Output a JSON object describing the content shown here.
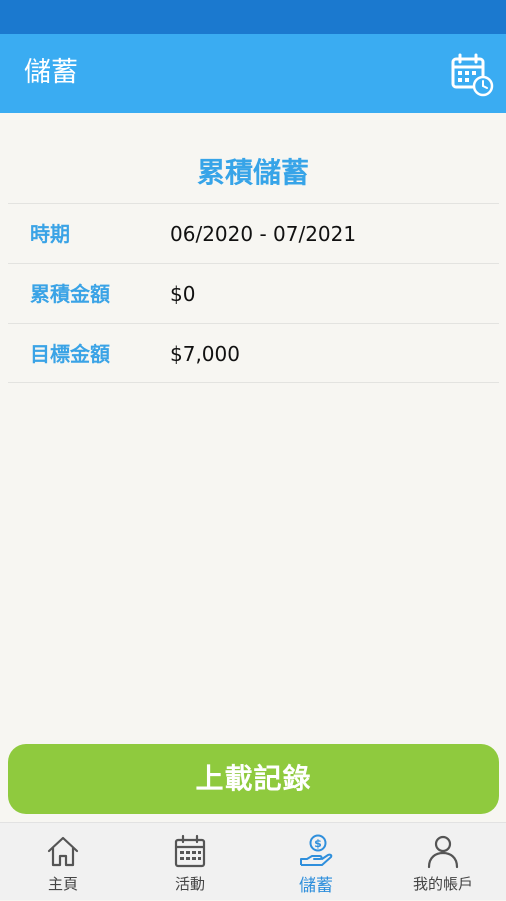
{
  "app_bar": {
    "title": "儲蓄",
    "calendar_icon": "calendar-clock-icon"
  },
  "summary": {
    "title": "累積儲蓄",
    "rows": [
      {
        "label": "時期",
        "value": "06/2020 - 07/2021"
      },
      {
        "label": "累積金額",
        "value": "$0"
      },
      {
        "label": "目標金額",
        "value": "$7,000"
      }
    ]
  },
  "actions": {
    "upload_label": "上載記錄"
  },
  "bottom_nav": {
    "items": [
      {
        "label": "主頁",
        "icon": "home-icon",
        "active": false
      },
      {
        "label": "活動",
        "icon": "calendar-icon",
        "active": false
      },
      {
        "label": "儲蓄",
        "icon": "savings-hand-dollar-icon",
        "active": true
      },
      {
        "label": "我的帳戶",
        "icon": "user-icon",
        "active": false
      }
    ]
  },
  "colors": {
    "status_bar": "#1b79cf",
    "app_bar": "#3aacf2",
    "accent_text": "#37a4e8",
    "button_green": "#8fca3e",
    "nav_active": "#2f8fdc",
    "background": "#f7f6f2"
  }
}
